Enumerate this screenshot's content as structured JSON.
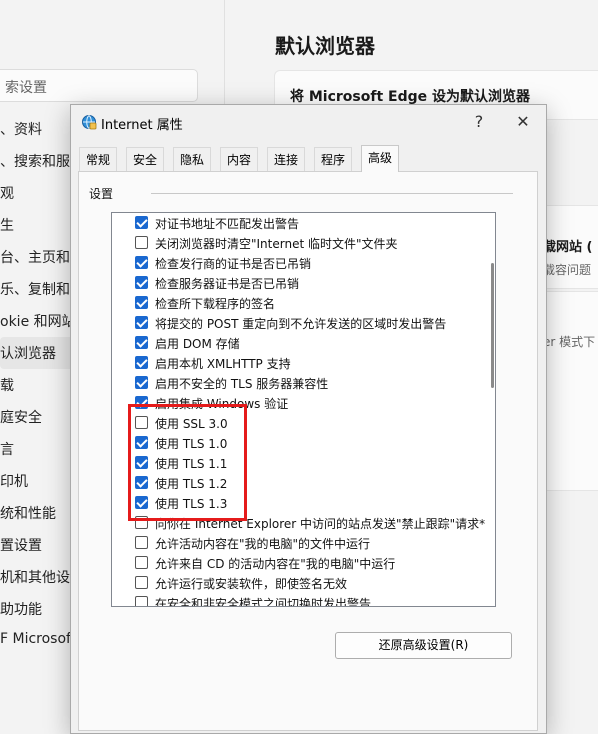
{
  "background": {
    "search_placeholder": "索设置",
    "nav_items": [
      {
        "label": "、资料",
        "active": false
      },
      {
        "label": "、搜索和服",
        "active": false
      },
      {
        "label": "观",
        "active": false
      },
      {
        "label": "生",
        "active": false
      },
      {
        "label": "台、主页和新",
        "active": false
      },
      {
        "label": "乐、复制和粘",
        "active": false
      },
      {
        "label": "okie 和网站",
        "active": false
      },
      {
        "label": "认浏览器",
        "active": true
      },
      {
        "label": "载",
        "active": false
      },
      {
        "label": "庭安全",
        "active": false
      },
      {
        "label": "言",
        "active": false
      },
      {
        "label": "印机",
        "active": false
      },
      {
        "label": "统和性能",
        "active": false
      },
      {
        "label": "置设置",
        "active": false
      },
      {
        "label": "机和其他设备",
        "active": false
      },
      {
        "label": "助功能",
        "active": false
      },
      {
        "label": "F Microsoft",
        "active": false
      }
    ],
    "page_title": "默认浏览器",
    "card_title": "将 Microsoft Edge 设为默认浏览器",
    "right_text_1": "载网站 (",
    "right_text_2": "载容问题",
    "right_text_3": "er 模式下"
  },
  "dialog": {
    "title": "Internet 属性",
    "help_label": "?",
    "close_label": "✕",
    "tabs": [
      {
        "label": "常规",
        "active": false
      },
      {
        "label": "安全",
        "active": false
      },
      {
        "label": "隐私",
        "active": false
      },
      {
        "label": "内容",
        "active": false
      },
      {
        "label": "连接",
        "active": false
      },
      {
        "label": "程序",
        "active": false
      },
      {
        "label": "高级",
        "active": true
      }
    ],
    "group_label": "设置",
    "settings": [
      {
        "label": "对证书地址不匹配发出警告",
        "checked": true
      },
      {
        "label": "关闭浏览器时清空\"Internet 临时文件\"文件夹",
        "checked": false
      },
      {
        "label": "检查发行商的证书是否已吊销",
        "checked": true
      },
      {
        "label": "检查服务器证书是否已吊销",
        "checked": true
      },
      {
        "label": "检查所下载程序的签名",
        "checked": true
      },
      {
        "label": "将提交的 POST 重定向到不允许发送的区域时发出警告",
        "checked": true
      },
      {
        "label": "启用 DOM 存储",
        "checked": true
      },
      {
        "label": "启用本机 XMLHTTP 支持",
        "checked": true
      },
      {
        "label": "启用不安全的 TLS 服务器兼容性",
        "checked": true
      },
      {
        "label": "启用集成 Windows 验证",
        "checked": true
      },
      {
        "label": "使用 SSL 3.0",
        "checked": false
      },
      {
        "label": "使用 TLS 1.0",
        "checked": true
      },
      {
        "label": "使用 TLS 1.1",
        "checked": true
      },
      {
        "label": "使用 TLS 1.2",
        "checked": true
      },
      {
        "label": "使用 TLS 1.3",
        "checked": true
      },
      {
        "label": "向你在 Internet Explorer 中访问的站点发送\"禁止跟踪\"请求*",
        "checked": false
      },
      {
        "label": "允许活动内容在\"我的电脑\"的文件中运行",
        "checked": false
      },
      {
        "label": "允许来自 CD 的活动内容在\"我的电脑\"中运行",
        "checked": false
      },
      {
        "label": "允许运行或安装软件，即使签名无效",
        "checked": false
      },
      {
        "label": "在安全和非安全模式之间切换时发出警告",
        "checked": false
      }
    ],
    "restore_button": "还原高级设置(R)"
  },
  "colors": {
    "checkbox_checked": "#1a68d0",
    "highlight_box": "#e51b1b"
  },
  "icons": {
    "title_icon": "internet-options-icon"
  }
}
